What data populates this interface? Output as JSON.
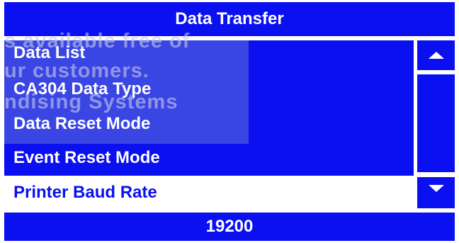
{
  "header": {
    "title": "Data Transfer"
  },
  "menu": {
    "items": [
      {
        "label": "Data List"
      },
      {
        "label": "CA304 Data Type"
      },
      {
        "label": "Data Reset Mode"
      },
      {
        "label": "Event Reset Mode"
      },
      {
        "label": "Printer Baud Rate"
      }
    ],
    "selected_index": 4
  },
  "value_bar": {
    "value": "19200"
  },
  "watermark": {
    "lines": [
      "s available free of",
      "ur customers.",
      "ndising Systems"
    ]
  },
  "icons": {
    "scroll_up": "triangle-up-icon",
    "scroll_down": "triangle-down-icon"
  },
  "colors": {
    "primary_blue": "#0a10f0",
    "background": "#ffffff",
    "text_on_blue": "#ffffff",
    "text_on_white": "#0a10f0"
  }
}
